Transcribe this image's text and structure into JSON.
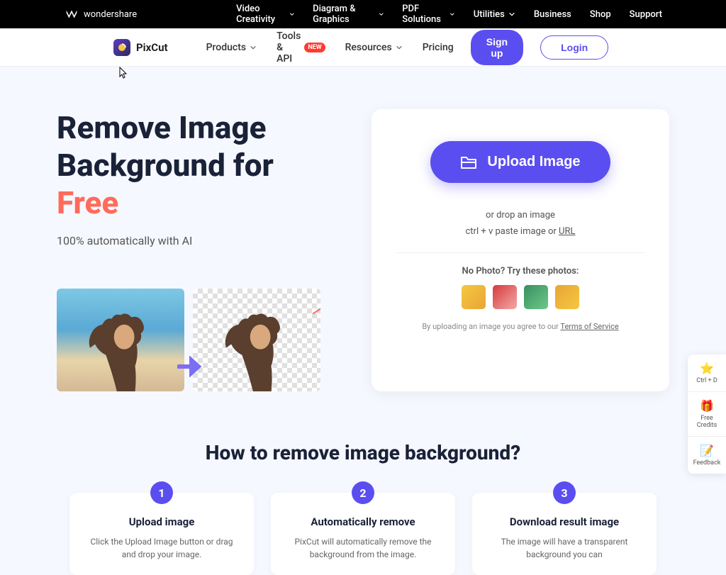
{
  "topbar": {
    "brand": "wondershare",
    "items": [
      {
        "label": "Video Creativity",
        "dropdown": true
      },
      {
        "label": "Diagram & Graphics",
        "dropdown": true
      },
      {
        "label": "PDF Solutions",
        "dropdown": true
      },
      {
        "label": "Utilities",
        "dropdown": true
      },
      {
        "label": "Business",
        "dropdown": false
      },
      {
        "label": "Shop",
        "dropdown": false
      },
      {
        "label": "Support",
        "dropdown": false
      }
    ]
  },
  "subbar": {
    "product": "PixCut",
    "items": [
      {
        "label": "Products",
        "dropdown": true,
        "badge": null
      },
      {
        "label": "Tools & API",
        "dropdown": false,
        "badge": "NEW"
      },
      {
        "label": "Resources",
        "dropdown": true,
        "badge": null
      },
      {
        "label": "Pricing",
        "dropdown": false,
        "badge": null
      }
    ],
    "signup": "Sign up",
    "login": "Login"
  },
  "hero": {
    "title_main": "Remove Image Background for ",
    "title_accent": "Free",
    "subtitle": "100% automatically with AI"
  },
  "upload": {
    "button": "Upload Image",
    "drop": "or drop an image",
    "paste_prefix": "ctrl + v paste image or ",
    "paste_link": "URL",
    "no_photo": "No Photo? Try these photos:",
    "terms_prefix": "By uploading an image you agree to our ",
    "terms_link": "Terms of Service"
  },
  "howto": {
    "title": "How to remove image background?",
    "steps": [
      {
        "num": "1",
        "title": "Upload image",
        "desc": "Click the Upload Image button or drag and drop your image."
      },
      {
        "num": "2",
        "title": "Automatically remove",
        "desc": "PixCut will automatically remove the background from the image."
      },
      {
        "num": "3",
        "title": "Download result image",
        "desc": "The image will have a transparent background you can"
      }
    ]
  },
  "float": {
    "bookmark": "Ctrl + D",
    "credits": "Free Credits",
    "feedback": "Feedback"
  }
}
